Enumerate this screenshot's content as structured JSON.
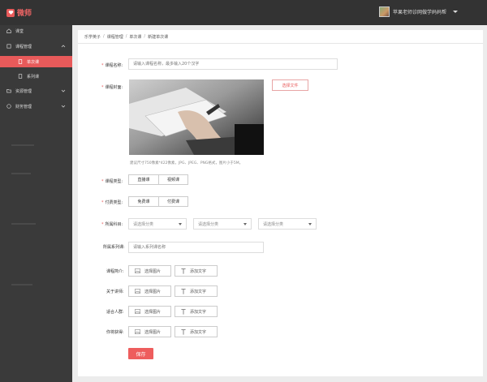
{
  "header": {
    "brand": "微师",
    "user_name": "苹果老师诊网做学妈妈帮"
  },
  "sidebar": {
    "items": [
      {
        "label": "课堂"
      },
      {
        "label": "课程管理"
      },
      {
        "label": "单次课"
      },
      {
        "label": "系列课"
      },
      {
        "label": "资源管理"
      },
      {
        "label": "财务管理"
      }
    ]
  },
  "breadcrumb": [
    "乐学英子",
    "课程管理",
    "单次课",
    "新建单次课"
  ],
  "form": {
    "course_name": {
      "label": "课程名称:",
      "placeholder": "请输入课程名称，最多输入20个汉字"
    },
    "cover": {
      "label": "课程封面:",
      "button": "选择文件",
      "hint": "建议尺寸750像素*422像素，JPG、JPEG、PNG格式，图片小于5M。"
    },
    "course_type": {
      "label": "课程类型:",
      "options": [
        "直播课",
        "视频课"
      ]
    },
    "pay_type": {
      "label": "付费类型:",
      "options": [
        "免费课",
        "付费课"
      ]
    },
    "subject": {
      "label": "所属科目:",
      "selects": [
        "请选择分类",
        "请选择分类",
        "请选择分类"
      ]
    },
    "series": {
      "label": "所属系列课:",
      "placeholder": "请输入系列课名称"
    },
    "intro": {
      "label": "课程简介:"
    },
    "about_teacher": {
      "label": "关于讲师:"
    },
    "audience": {
      "label": "适合人群:"
    },
    "gain": {
      "label": "你将获得:"
    },
    "pick_image": "选择图片",
    "add_text": "添加文字",
    "save": "保存"
  },
  "colors": {
    "accent": "#e85a5a",
    "topbar": "#333333",
    "sidebar": "#3a3a3a"
  }
}
